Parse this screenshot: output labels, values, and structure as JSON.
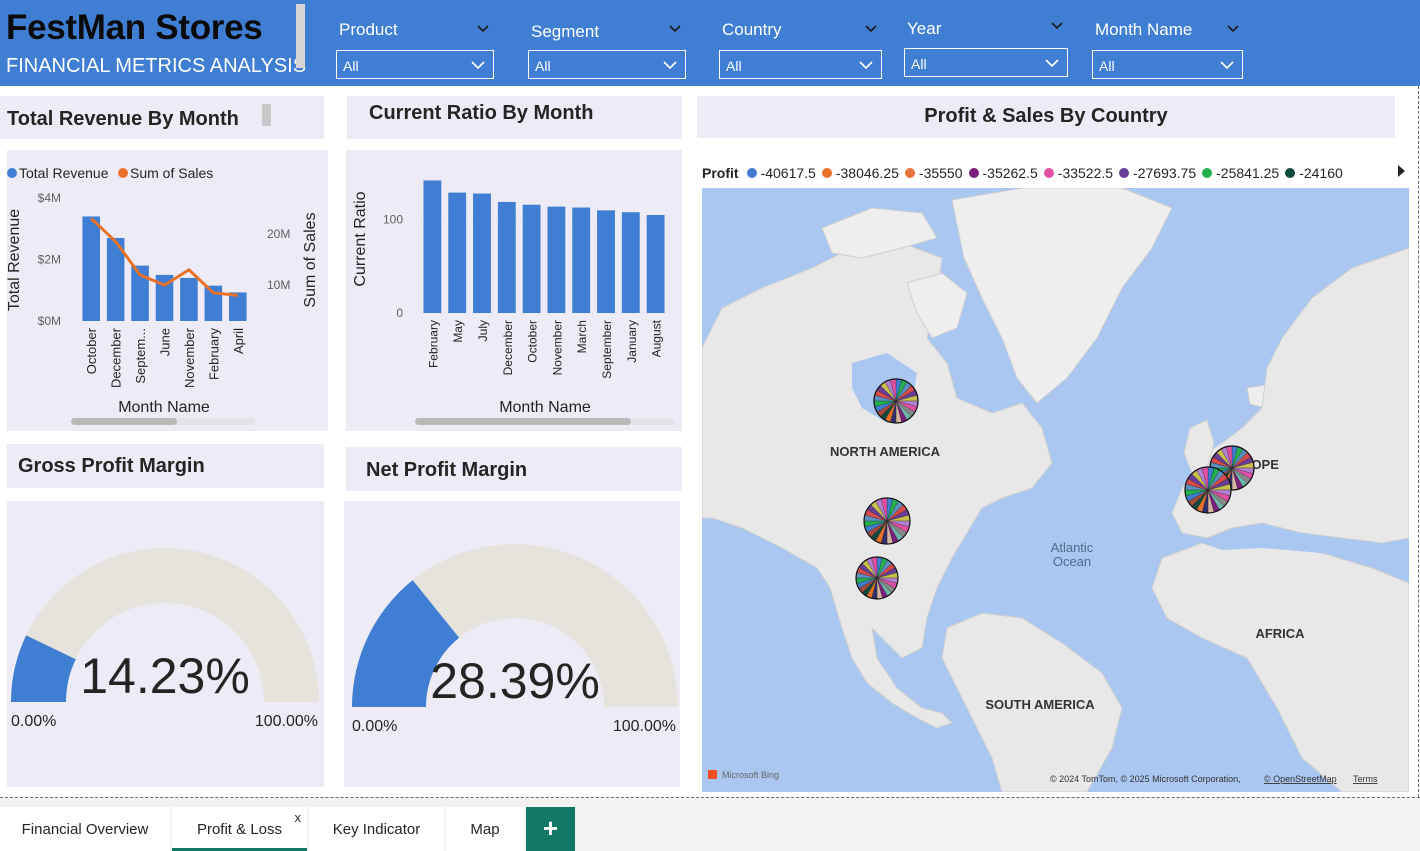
{
  "header": {
    "title": "FestMan Stores",
    "subtitle": "FINANCIAL METRICS ANALYSIS",
    "slicers": [
      {
        "label": "Product",
        "value": "All"
      },
      {
        "label": "Segment",
        "value": "All"
      },
      {
        "label": "Country",
        "value": "All"
      },
      {
        "label": "Year",
        "value": "All"
      },
      {
        "label": "Month Name",
        "value": "All"
      }
    ]
  },
  "panels": {
    "revenue_title": "Total Revenue By Month",
    "ratio_title": "Current Ratio By Month",
    "map_title": "Profit  & Sales By Country",
    "gross_title": "Gross Profit Margin",
    "net_title": "Net Profit Margin"
  },
  "gauges": {
    "gross": {
      "value": 0.1423,
      "label": "14.23%",
      "min": "0.00%",
      "max": "100.00%"
    },
    "net": {
      "value": 0.2839,
      "label": "28.39%",
      "min": "0.00%",
      "max": "100.00%"
    }
  },
  "chart_data": [
    {
      "type": "bar",
      "title": "Total Revenue By Month",
      "xlabel": "Month Name",
      "ylabel": "Total Revenue",
      "y2label": "Sum of Sales",
      "categories": [
        "October",
        "December",
        "Septem...",
        "June",
        "November",
        "February",
        "April"
      ],
      "series": [
        {
          "name": "Total Revenue",
          "type": "bar",
          "color": "#3f7ed3",
          "values": [
            3.4,
            2.7,
            1.8,
            1.5,
            1.4,
            1.15,
            0.93
          ],
          "axis": "left"
        },
        {
          "name": "Sum of  Sales",
          "type": "line",
          "color": "#e8712a",
          "values": [
            23,
            18.5,
            12,
            10,
            13,
            8.5,
            8
          ],
          "axis": "right"
        }
      ],
      "y_ticks": [
        "$0M",
        "$2M",
        "$4M"
      ],
      "ylim": [
        0,
        4
      ],
      "y2_ticks": [
        "10M",
        "20M"
      ],
      "y2lim": [
        3,
        27
      ],
      "legend": "top-left"
    },
    {
      "type": "bar",
      "title": "Current Ratio By Month",
      "xlabel": "Month Name",
      "ylabel": "Current Ratio",
      "categories": [
        "February",
        "May",
        "July",
        "December",
        "October",
        "November",
        "March",
        "September",
        "January",
        "August"
      ],
      "values": [
        142,
        129,
        128,
        119,
        116,
        114,
        113,
        110,
        108,
        105
      ],
      "y_ticks": [
        "0",
        "100"
      ],
      "ylim": [
        0,
        150
      ],
      "color": "#3f7ed3"
    }
  ],
  "map": {
    "legend_label": "Profit",
    "legend": [
      {
        "value": "-40617.5",
        "color": "#3f7ed3"
      },
      {
        "value": "-38046.25",
        "color": "#e8712a"
      },
      {
        "value": "-35550",
        "color": "#e8713c"
      },
      {
        "value": "-35262.5",
        "color": "#7a1f7c"
      },
      {
        "value": "-33522.5",
        "color": "#e44fa6"
      },
      {
        "value": "-27693.75",
        "color": "#673d96"
      },
      {
        "value": "-25841.25",
        "color": "#22b14c"
      },
      {
        "value": "-24160",
        "color": "#0f4a3c"
      }
    ],
    "labels": {
      "north_america": "NORTH AMERICA",
      "europe": "EUROPE",
      "africa": "AFRICA",
      "south_america": "SOUTH AMERICA",
      "ocean_1": "Atlantic",
      "ocean_2": "Ocean"
    },
    "bing": "Microsoft Bing",
    "attribution": "© 2024 TomTom, © 2025 Microsoft Corporation,",
    "osm": "© OpenStreetMap",
    "terms": "Terms"
  },
  "tabs": [
    {
      "label": "Financial Overview",
      "active": false
    },
    {
      "label": "Profit & Loss",
      "active": true,
      "close": "x"
    },
    {
      "label": "Key Indicator",
      "active": false
    },
    {
      "label": "Map",
      "active": false
    }
  ],
  "add_tab": "+"
}
